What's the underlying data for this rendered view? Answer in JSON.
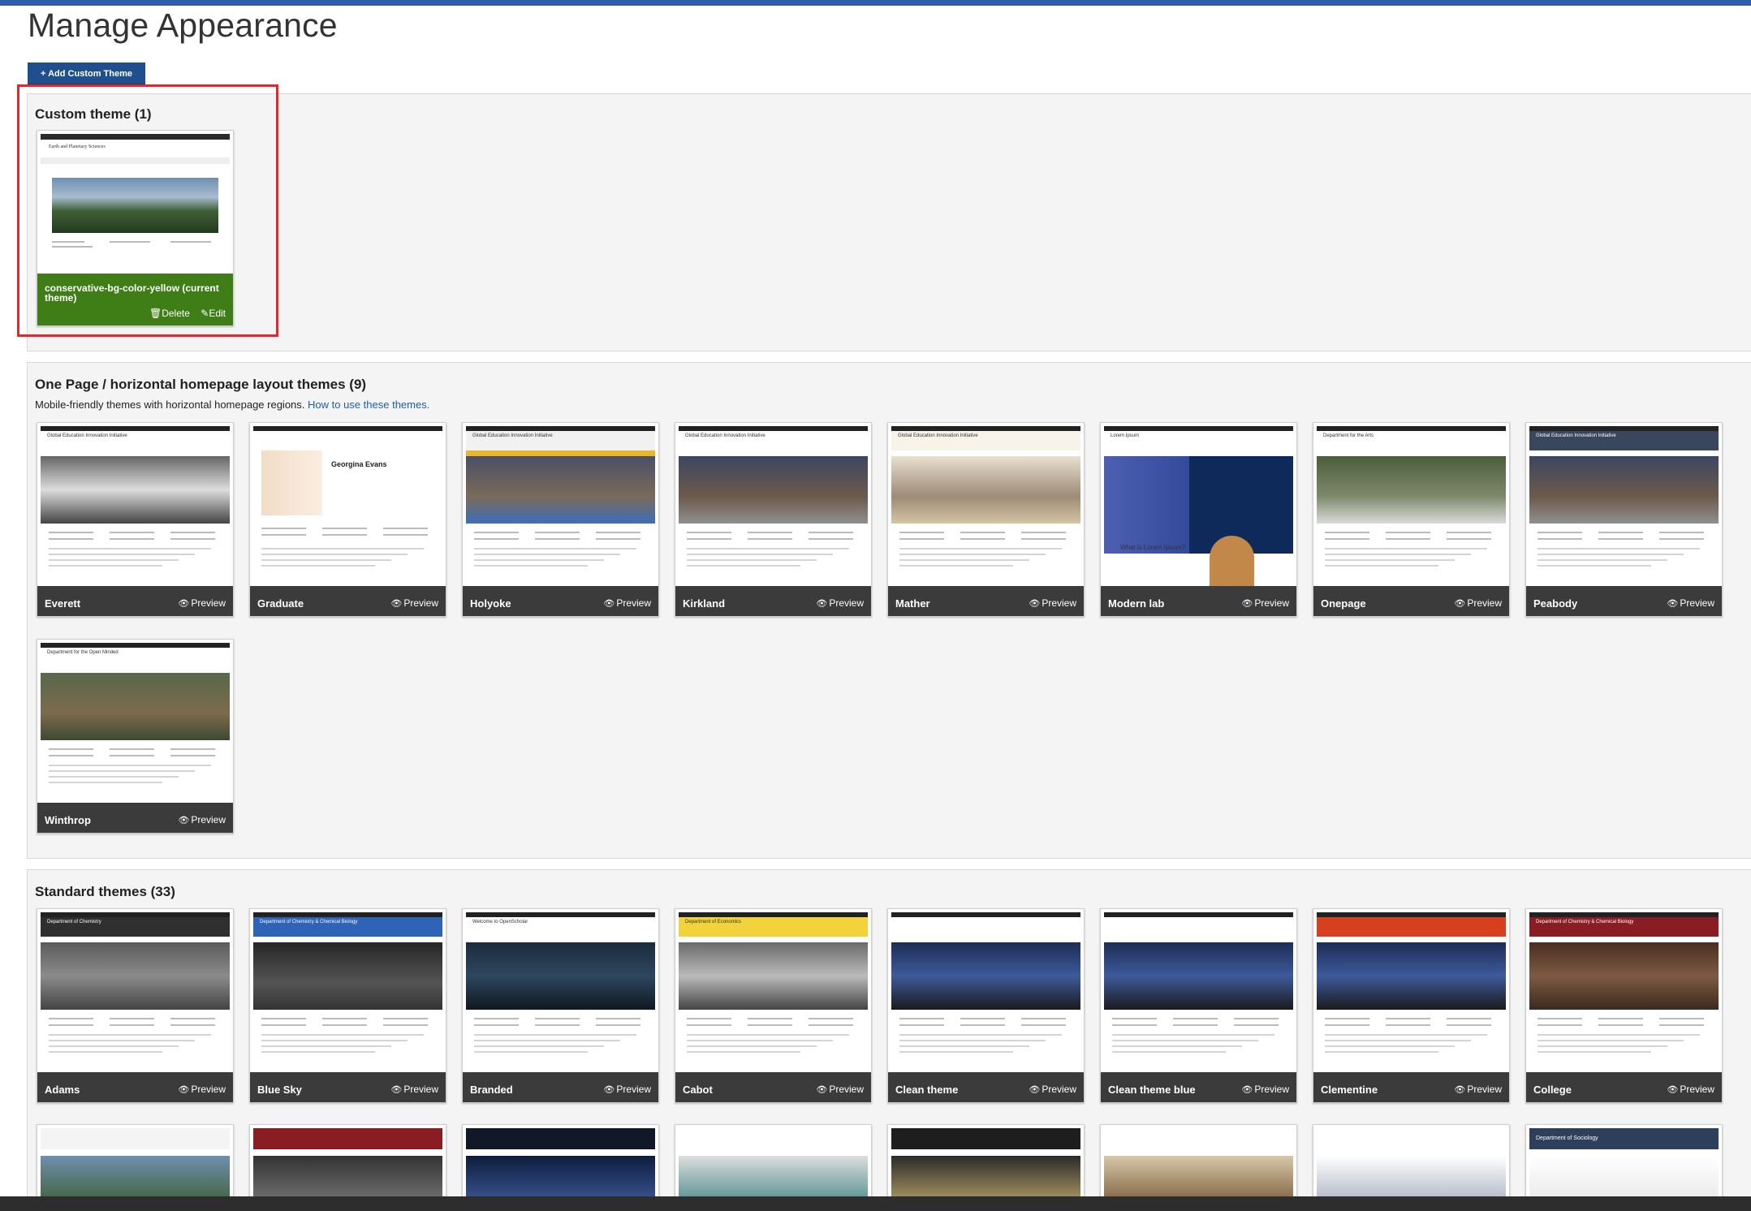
{
  "page": {
    "title": "Manage Appearance"
  },
  "toolbar": {
    "add_button": "+ Add Custom Theme"
  },
  "sections": {
    "custom": {
      "title": "Custom theme (1)",
      "card": {
        "name": "conservative-bg-color-yellow (current theme)",
        "delete": "Delete",
        "edit": "Edit"
      }
    },
    "onepage": {
      "title": "One Page / horizontal homepage layout themes (9)",
      "desc": "Mobile-friendly themes with horizontal homepage regions.",
      "link": "How to use these themes.",
      "themes": [
        {
          "name": "Everett"
        },
        {
          "name": "Graduate"
        },
        {
          "name": "Holyoke"
        },
        {
          "name": "Kirkland"
        },
        {
          "name": "Mather"
        },
        {
          "name": "Modern lab"
        },
        {
          "name": "Onepage"
        },
        {
          "name": "Peabody"
        },
        {
          "name": "Winthrop"
        }
      ]
    },
    "standard": {
      "title": "Standard themes (33)",
      "themes": [
        {
          "name": "Adams"
        },
        {
          "name": "Blue Sky"
        },
        {
          "name": "Branded"
        },
        {
          "name": "Cabot"
        },
        {
          "name": "Clean theme"
        },
        {
          "name": "Clean theme blue"
        },
        {
          "name": "Clementine"
        },
        {
          "name": "College"
        }
      ]
    }
  },
  "preview_label": "Preview",
  "thumbnail_text": {
    "everett_site": "Global Education Innovation Initiative",
    "graduate_person": "Georgina Evans",
    "holyoke_site": "Global Education Innovation Initiative",
    "kirkland_site": "Global Education Innovation Initiative",
    "mather_site": "Global Education Innovation Initiative",
    "modernlab_hero": "Lorem Ipsum",
    "modernlab_q": "What is Lorem Ipsum?",
    "onepage_site": "Department for the Arts",
    "peabody_site": "Global Education Innovation Initiative",
    "winthrop_site": "Department for the Open Minded",
    "custom_dept": "Earth and Planetary Sciences",
    "adams_dept": "Department of Chemistry",
    "bluesky_dept": "Department of Chemistry & Chemical Biology",
    "branded_welcome": "Welcome to OpenScholar",
    "cabot_dept": "Department of Economics",
    "college_dept": "Department of Chemistry & Chemical Biology",
    "r2_sociology": "Department of Sociology"
  },
  "colors": {
    "accent": "#1f4f8c",
    "current_theme": "#3f7d17",
    "highlight": "#e0282e",
    "card_bar": "#3b3b3b"
  },
  "icons": {
    "preview": "eye-icon",
    "delete": "trash-icon",
    "edit": "edit-icon"
  }
}
